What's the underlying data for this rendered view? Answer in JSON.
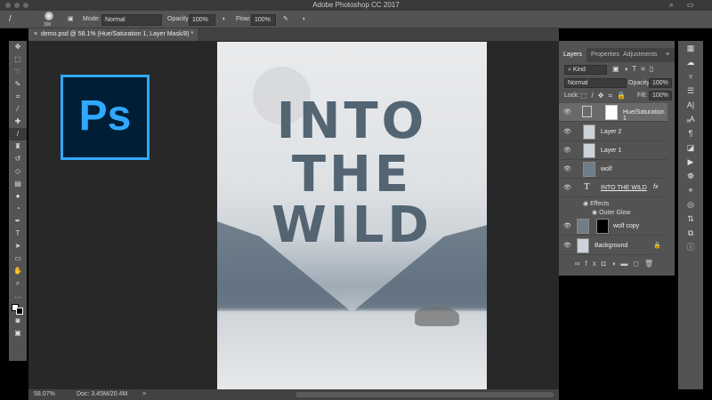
{
  "app": {
    "title": "Adobe Photoshop CC 2017"
  },
  "options": {
    "brush_size": "300",
    "mode_label": "Mode:",
    "mode_value": "Normal",
    "opacity_label": "Opacity:",
    "opacity_value": "100%",
    "flow_label": "Flow:",
    "flow_value": "100%"
  },
  "document_tab": {
    "title": "demo.psd @ 58.1% (Hue/Saturation 1, Layer Mask/8) *",
    "close": "×"
  },
  "poster": {
    "line1": "INTO",
    "line2": "THE",
    "line3": "WILD"
  },
  "logo": {
    "text": "Ps",
    "bg": "#001e36",
    "accent": "#31a8ff"
  },
  "tools": [
    "move-icon",
    "marquee-icon",
    "lasso-icon",
    "quick-select-icon",
    "crop-icon",
    "eyedropper-icon",
    "healing-icon",
    "brush-icon",
    "stamp-icon",
    "history-brush-icon",
    "eraser-icon",
    "gradient-icon",
    "blur-icon",
    "dodge-icon",
    "pen-icon",
    "type-icon",
    "path-select-icon",
    "rectangle-icon",
    "hand-icon",
    "zoom-icon",
    "more-icon",
    "colors-icon",
    "quickmask-icon",
    "screenmode-icon"
  ],
  "layers_panel": {
    "tabs": [
      "Layers",
      "Properties",
      "Adjustments"
    ],
    "filter": "Kind",
    "blend_mode": "Normal",
    "opacity_label": "Opacity:",
    "opacity_value": "100%",
    "lock_label": "Lock:",
    "fill_label": "Fill:",
    "fill_value": "100%",
    "layers": [
      {
        "name": "Hue/Saturation 1",
        "selected": true
      },
      {
        "name": "Layer 2"
      },
      {
        "name": "Layer 1"
      },
      {
        "name": "wolf"
      },
      {
        "name": "INTO THE WILD",
        "fx": "fx"
      },
      {
        "name": "Effects"
      },
      {
        "name": "Outer Glow"
      },
      {
        "name": "wolf copy"
      },
      {
        "name": "Background"
      }
    ]
  },
  "status": {
    "zoom": "58.07%",
    "doc": "Doc: 3.45M/20.4M",
    "arrow": ">"
  }
}
